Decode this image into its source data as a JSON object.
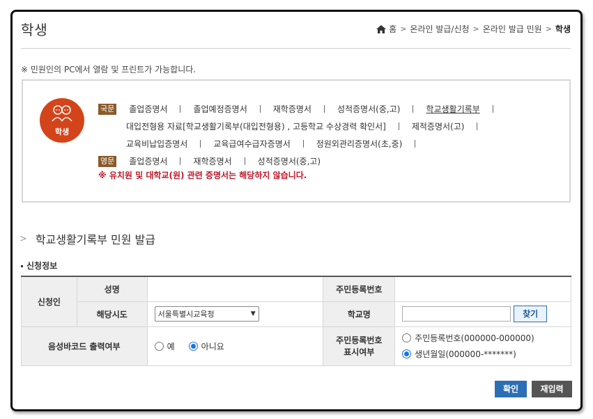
{
  "header": {
    "title": "학생",
    "breadcrumb": [
      "홈",
      "온라인 발급/신청",
      "온라인 발급 민원",
      "학생"
    ]
  },
  "notice": "※ 민원인의 PC에서 열람 및 프린트가 가능합니다.",
  "cert_box": {
    "avatar_label": "학생",
    "korean_badge": "국문",
    "english_badge": "영문",
    "korean_row1": [
      "졸업증명서",
      "졸업예정증명서",
      "재학증명서",
      "성적증명서(중,고)",
      "학교생활기록부"
    ],
    "korean_row2": [
      "대입전형용 자료[학교생활기록부(대입전형용) , 고등학교 수상경력 확인서]",
      "제적증명서(고)"
    ],
    "korean_row3": [
      "교육비납입증명서",
      "교육급여수급자증명서",
      "정원외관리증명서(초,중)"
    ],
    "english_row": [
      "졸업증명서",
      "재학증명서",
      "성적증명서(중,고)"
    ],
    "warning": "※ 유치원 및 대학교(원) 관련 증명서는 해당하지 않습니다."
  },
  "section_title": "학교생활기록부 민원 발급",
  "sub_title": "신청정보",
  "form": {
    "applicant_label": "신청인",
    "name_label": "성명",
    "name_value": "",
    "rrn_label": "주민등록번호",
    "rrn_value": "",
    "region_label": "해당시도",
    "region_value": "서울특별시교육청",
    "school_label": "학교명",
    "school_value": "",
    "find_button": "찾기",
    "barcode_label": "음성바코드 출력여부",
    "barcode_yes": "예",
    "barcode_no": "아니요",
    "barcode_selected": "아니요",
    "rrn_display_label_1": "주민등록번호",
    "rrn_display_label_2": "표시여부",
    "rrn_display_opt1": "주민등록번호(000000-000000)",
    "rrn_display_opt2": "생년월일(000000-*******)",
    "rrn_display_selected": "생년월일(000000-*******)"
  },
  "buttons": {
    "confirm": "확인",
    "reset": "재입력"
  },
  "colors": {
    "accent_orange": "#d4441a",
    "badge_brown": "#8a5a2a",
    "warning_red": "#c0182a",
    "confirm_blue": "#2c6fb4",
    "reset_gray": "#555555"
  }
}
